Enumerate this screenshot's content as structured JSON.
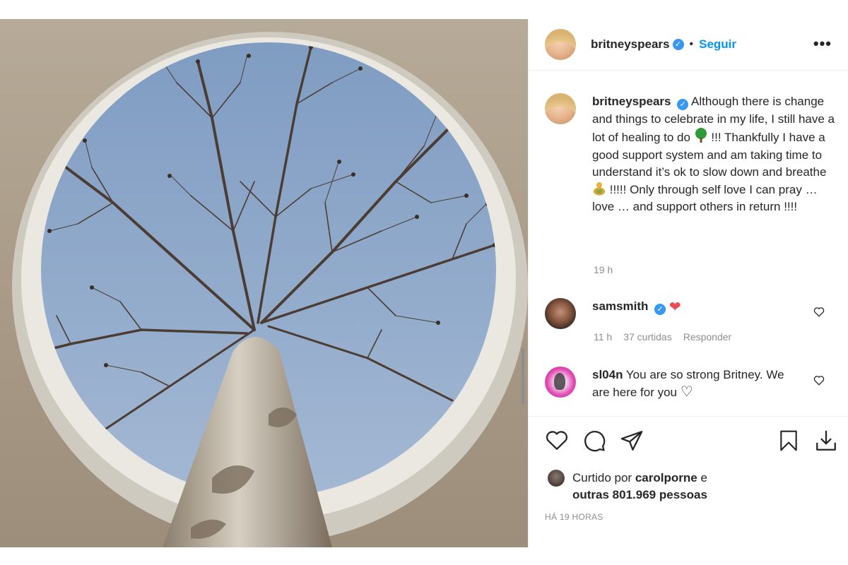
{
  "post": {
    "author": "britneyspears",
    "follow_label": "Seguir",
    "more_label": "•••",
    "caption_parts": [
      "Although there is change and things to celebrate in my life, I still have a lot of healing to do",
      "!!! Thankfully I have a good support system and am taking time to understand it’s ok to slow down and breathe",
      "!!!!! Only through self love I can pray … love … and support others in return !!!!"
    ],
    "caption_time": "19 h"
  },
  "comments": [
    {
      "username": "samsmith",
      "text": "❤",
      "time": "11 h",
      "likes": "37 curtidas",
      "reply_label": "Responder"
    },
    {
      "username": "sl04n",
      "text": "You are so strong Britney. We are here for you",
      "emoji": "♡"
    }
  ],
  "likes": {
    "prefix": "Curtido por",
    "user": "carolporne",
    "conj": "e",
    "others": "outras 801.969 pessoas"
  },
  "posted": "HÁ 19 HORAS",
  "colors": {
    "link": "#0095f6",
    "verified": "#3897f0",
    "muted": "#8e8e8e",
    "heart": "#ed4956"
  },
  "icons": [
    "verified-badge-icon",
    "more-options-icon",
    "heart-icon",
    "comment-icon",
    "share-icon",
    "bookmark-icon",
    "download-icon",
    "tree-emoji",
    "buddha-emoji"
  ]
}
